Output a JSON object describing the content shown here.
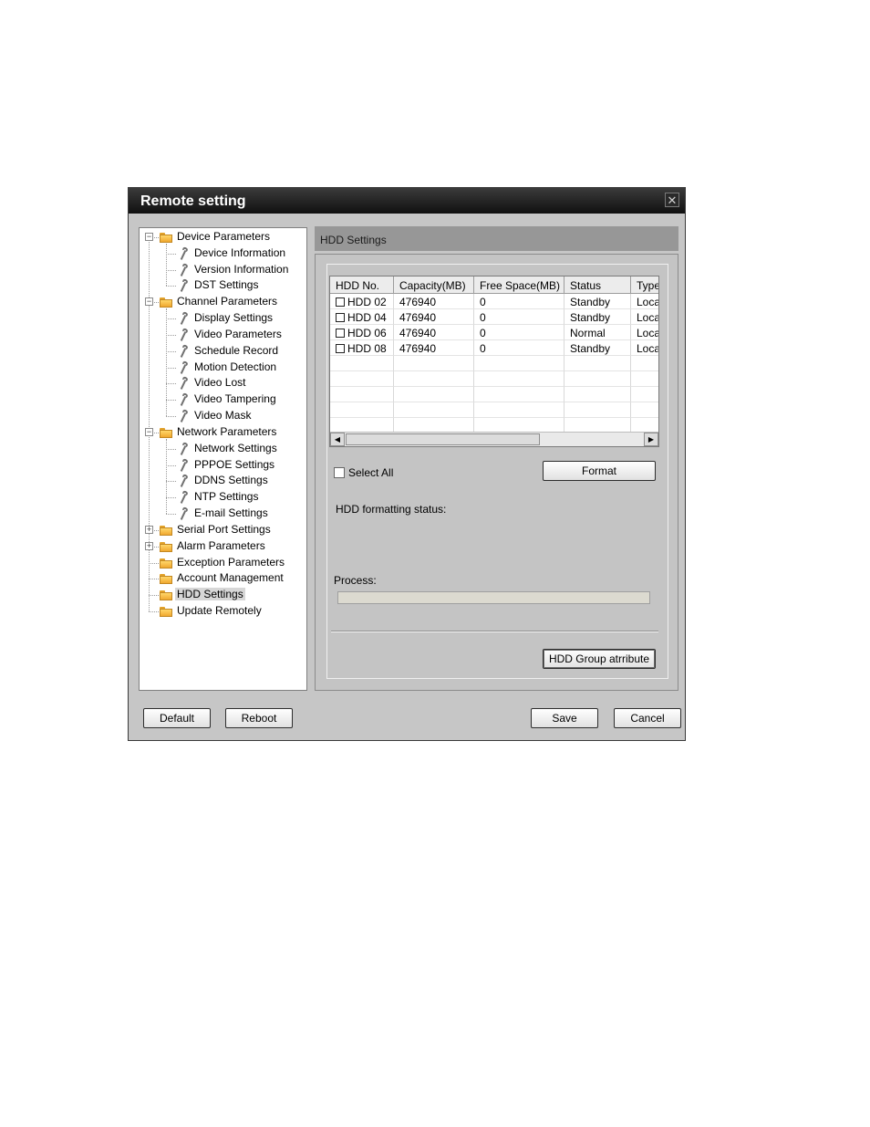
{
  "window": {
    "title": "Remote setting",
    "close_glyph": "✕"
  },
  "tree": {
    "nodes": [
      {
        "label": "Device Parameters",
        "level": 0,
        "icon": "folder-icon",
        "expander": "−"
      },
      {
        "label": "Device Information",
        "level": 1,
        "icon": "wrench-icon"
      },
      {
        "label": "Version Information",
        "level": 1,
        "icon": "wrench-icon"
      },
      {
        "label": "DST Settings",
        "level": 1,
        "icon": "wrench-icon"
      },
      {
        "label": "Channel Parameters",
        "level": 0,
        "icon": "folder-icon",
        "expander": "−"
      },
      {
        "label": "Display Settings",
        "level": 1,
        "icon": "wrench-icon"
      },
      {
        "label": "Video Parameters",
        "level": 1,
        "icon": "wrench-icon"
      },
      {
        "label": "Schedule Record",
        "level": 1,
        "icon": "wrench-icon"
      },
      {
        "label": "Motion Detection",
        "level": 1,
        "icon": "wrench-icon"
      },
      {
        "label": "Video Lost",
        "level": 1,
        "icon": "wrench-icon"
      },
      {
        "label": "Video Tampering",
        "level": 1,
        "icon": "wrench-icon"
      },
      {
        "label": "Video Mask",
        "level": 1,
        "icon": "wrench-icon"
      },
      {
        "label": "Network Parameters",
        "level": 0,
        "icon": "folder-icon",
        "expander": "−"
      },
      {
        "label": "Network Settings",
        "level": 1,
        "icon": "wrench-icon"
      },
      {
        "label": "PPPOE Settings",
        "level": 1,
        "icon": "wrench-icon"
      },
      {
        "label": "DDNS Settings",
        "level": 1,
        "icon": "wrench-icon"
      },
      {
        "label": "NTP Settings",
        "level": 1,
        "icon": "wrench-icon"
      },
      {
        "label": "E-mail Settings",
        "level": 1,
        "icon": "wrench-icon"
      },
      {
        "label": "Serial Port Settings",
        "level": 0,
        "icon": "folder-icon",
        "expander": "+"
      },
      {
        "label": "Alarm Parameters",
        "level": 0,
        "icon": "folder-icon",
        "expander": "+"
      },
      {
        "label": "Exception Parameters",
        "level": 0,
        "icon": "folder-icon"
      },
      {
        "label": "Account Management",
        "level": 0,
        "icon": "folder-icon"
      },
      {
        "label": "HDD Settings",
        "level": 0,
        "icon": "folder-icon",
        "selected": true
      },
      {
        "label": "Update Remotely",
        "level": 0,
        "icon": "folder-icon"
      }
    ]
  },
  "panel": {
    "header": "HDD Settings",
    "table": {
      "columns": [
        "HDD No.",
        "Capacity(MB)",
        "Free Space(MB)",
        "Status",
        "Type"
      ],
      "rows": [
        [
          "HDD 02",
          "476940",
          "0",
          "Standby",
          "Loca"
        ],
        [
          "HDD 04",
          "476940",
          "0",
          "Standby",
          "Loca"
        ],
        [
          "HDD 06",
          "476940",
          "0",
          "Normal",
          "Loca"
        ],
        [
          "HDD 08",
          "476940",
          "0",
          "Standby",
          "Loca"
        ]
      ],
      "scroll_left_glyph": "◀",
      "scroll_right_glyph": "▶"
    },
    "select_all_label": "Select All",
    "format_label": "Format",
    "status_label": "HDD formatting status:",
    "process_label": "Process:",
    "process_fraction": 0,
    "group_attr_label": "HDD Group atrribute"
  },
  "footer": {
    "default_label": "Default",
    "reboot_label": "Reboot",
    "save_label": "Save",
    "cancel_label": "Cancel"
  }
}
